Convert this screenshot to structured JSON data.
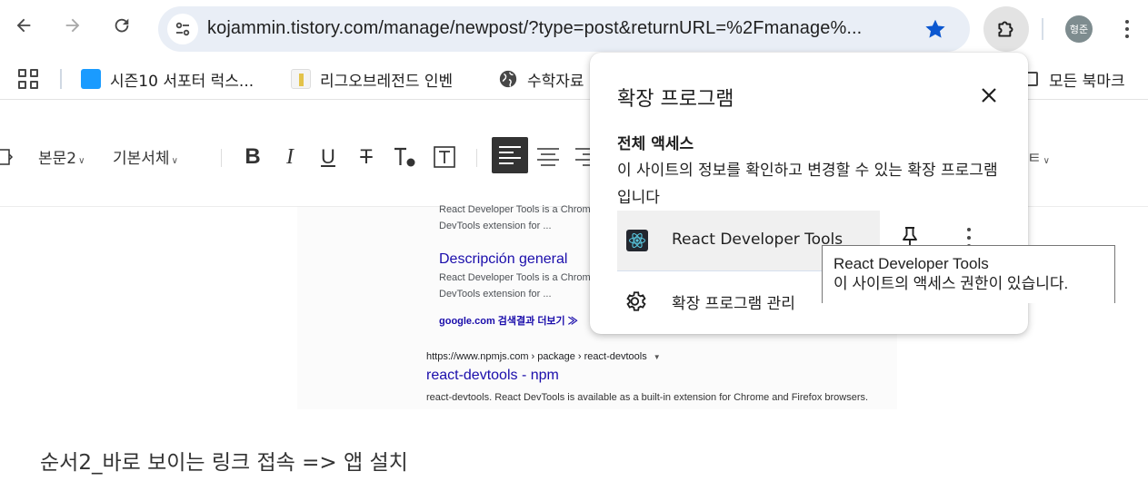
{
  "browser": {
    "url": "kojammin.tistory.com/manage/newpost/?type=post&returnURL=%2Fmanage%...",
    "profile_initials": "형준",
    "accent_color": "#0b57d0"
  },
  "bookmarks": {
    "items": [
      {
        "label": "시즌10 서포터 럭스...",
        "icon": "nexon-logo-icon",
        "color": "#1a9bff"
      },
      {
        "label": "리그오브레전드 인벤",
        "icon": "inven-logo-icon",
        "color": "#e3c34a"
      },
      {
        "label": "수학자료",
        "icon": "globe-icon",
        "color": "#474747"
      }
    ],
    "all_bookmarks_label": "모든 북마크"
  },
  "editor": {
    "paragraph_style": "본문2",
    "font_family": "기본서체",
    "body_text": "순서2_바로 보이는 링크 접속 => 앱 설치"
  },
  "embedded_results": {
    "r1_snippet_a": "React Developer Tools is a Chrom",
    "r1_snippet_b": "DevTools extension for ...",
    "r2_title": "Descripción general",
    "r2_snippet_a": "React Developer Tools is a Chrom",
    "r2_snippet_b": "DevTools extension for ...",
    "more_link": "google.com 검색결과 더보기 ≫",
    "npm_breadcrumb": "https://www.npmjs.com › package › react-devtools",
    "npm_title": "react-devtools - npm",
    "npm_snippet": "react-devtools. React DevTools is available as a built-in extension for Chrome and Firefox browsers."
  },
  "extensions_popup": {
    "title": "확장 프로그램",
    "section_heading": "전체 액세스",
    "section_description": "이 사이트의 정보를 확인하고 변경할 수 있는 확장 프로그램입니다",
    "extension_name": "React Developer Tools",
    "manage_label": "확장 프로그램 관리"
  },
  "tooltip": {
    "line1": "React Developer Tools",
    "line2": "이 사이트의 액세스 권한이 있습니다."
  }
}
